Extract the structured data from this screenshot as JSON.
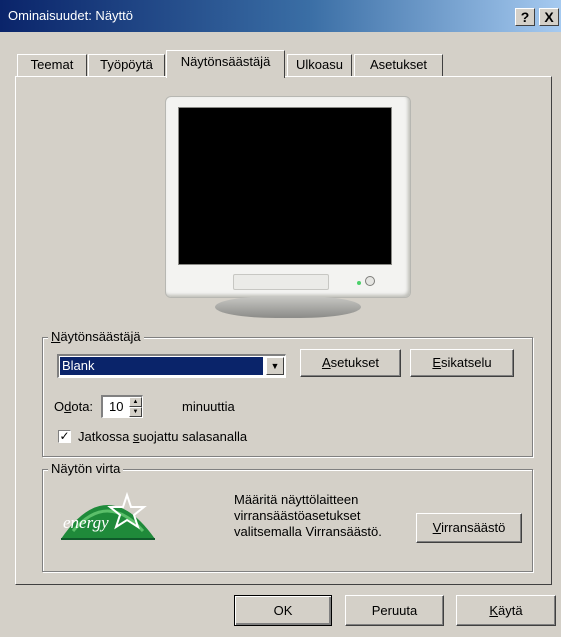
{
  "window": {
    "title": "Ominaisuudet: Näyttö",
    "help_label": "?",
    "close_label": "X"
  },
  "tabs": [
    {
      "label": "Teemat"
    },
    {
      "label": "Työpöytä"
    },
    {
      "label": "Näytönsäästäjä",
      "active": true
    },
    {
      "label": "Ulkoasu"
    },
    {
      "label": "Asetukset"
    }
  ],
  "screensaver": {
    "group_label": "Näytönsäästäjä",
    "selected": "Blank",
    "settings_label": "Asetukset",
    "preview_label": "Esikatselu",
    "wait_label": "Odota:",
    "wait_value": "10",
    "wait_unit": "minuuttia",
    "password_checked": true,
    "password_label": "Jatkossa suojattu salasanalla"
  },
  "power": {
    "group_label": "Näytön virta",
    "desc_line1": "Määritä näyttölaitteen",
    "desc_line2": "virransäästöasetukset",
    "desc_line3": "valitsemalla Virransäästö.",
    "button_label": "Virransäästö",
    "logo_text": "energy"
  },
  "footer": {
    "ok_label": "OK",
    "cancel_label": "Peruuta",
    "apply_label": "Käytä"
  },
  "colors": {
    "titlebar_start": "#0a246a",
    "titlebar_end": "#a6caf0",
    "face": "#d4d0c8",
    "selection": "#0a246a"
  }
}
